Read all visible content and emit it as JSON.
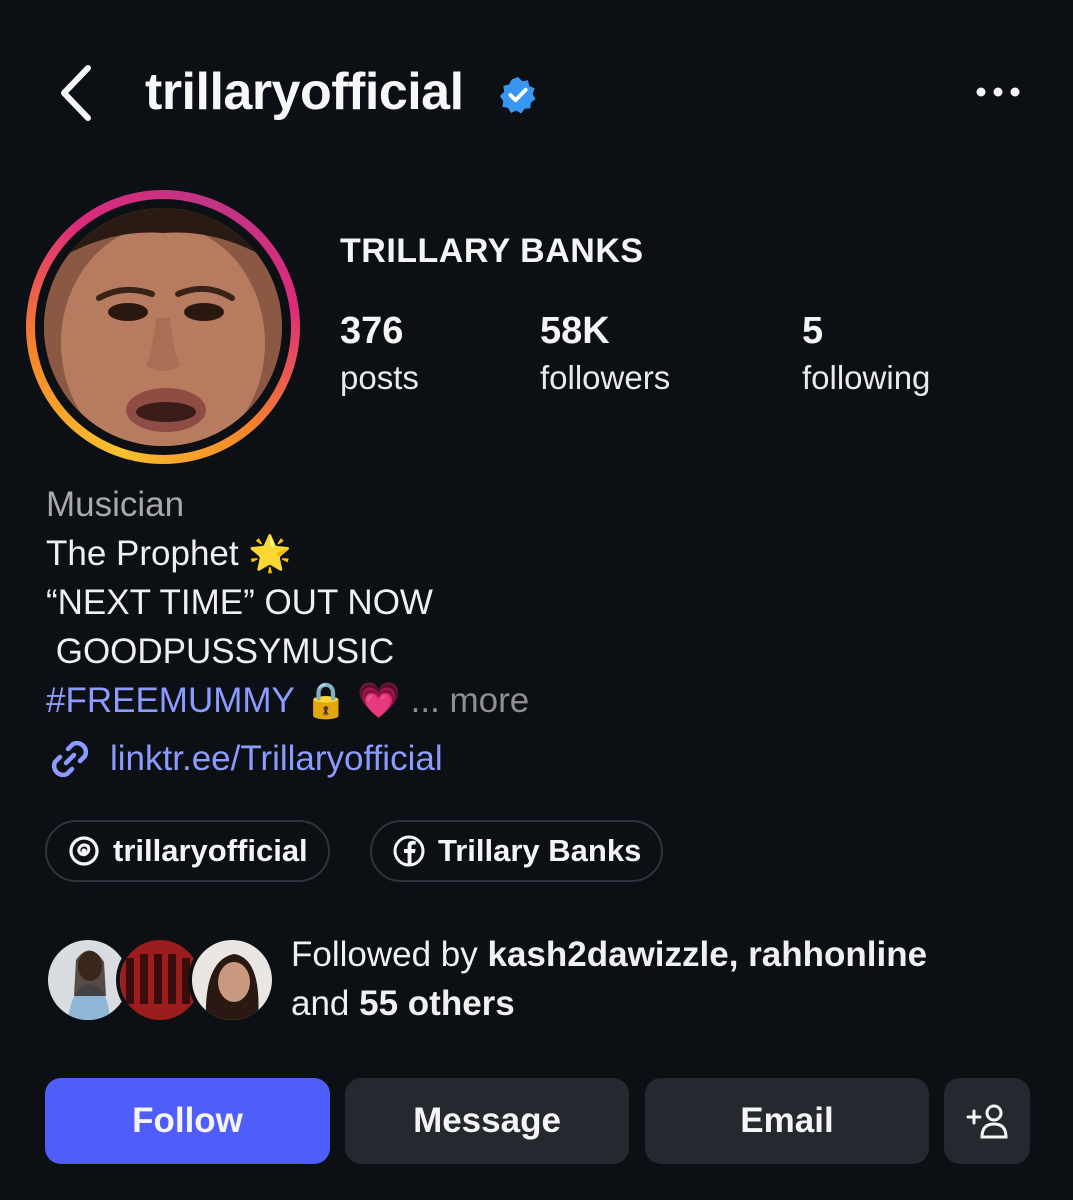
{
  "header": {
    "username": "trillaryofficial",
    "icons": {
      "back": "chevron-left-icon",
      "verified": "verified-badge-icon",
      "more": "more-dots-icon"
    },
    "verified_color": "#3897f0"
  },
  "profile": {
    "display_name": "TRILLARY BANKS",
    "stats": [
      {
        "value": "376",
        "label": "posts"
      },
      {
        "value": "58K",
        "label": "followers"
      },
      {
        "value": "5",
        "label": "following"
      }
    ]
  },
  "bio": {
    "category": "Musician",
    "line1": "The Prophet",
    "line1_emoji": "🌟",
    "line2": "“NEXT TIME” OUT NOW",
    "line3": " GOODPUSSYMUSIC",
    "hashtag": "#FREEMUMMY",
    "hashtag_emojis": "🔒 💗",
    "more": "... more",
    "link": "linktr.ee/Trillaryofficial"
  },
  "chips": [
    {
      "label": "trillaryofficial",
      "icon": "threads-icon"
    },
    {
      "label": "Trillary Banks",
      "icon": "facebook-icon"
    }
  ],
  "followed_by": {
    "prefix": "Followed by ",
    "users": "kash2dawizzle, rahhonline",
    "and": "and ",
    "others": "55 others"
  },
  "actions": {
    "follow": "Follow",
    "message": "Message",
    "email": "Email",
    "add_user_icon": "add-person-icon"
  },
  "colors": {
    "background": "#0c0f14",
    "accent": "#4f5dfa",
    "link": "#8c9bff",
    "button_secondary": "#25282e"
  }
}
